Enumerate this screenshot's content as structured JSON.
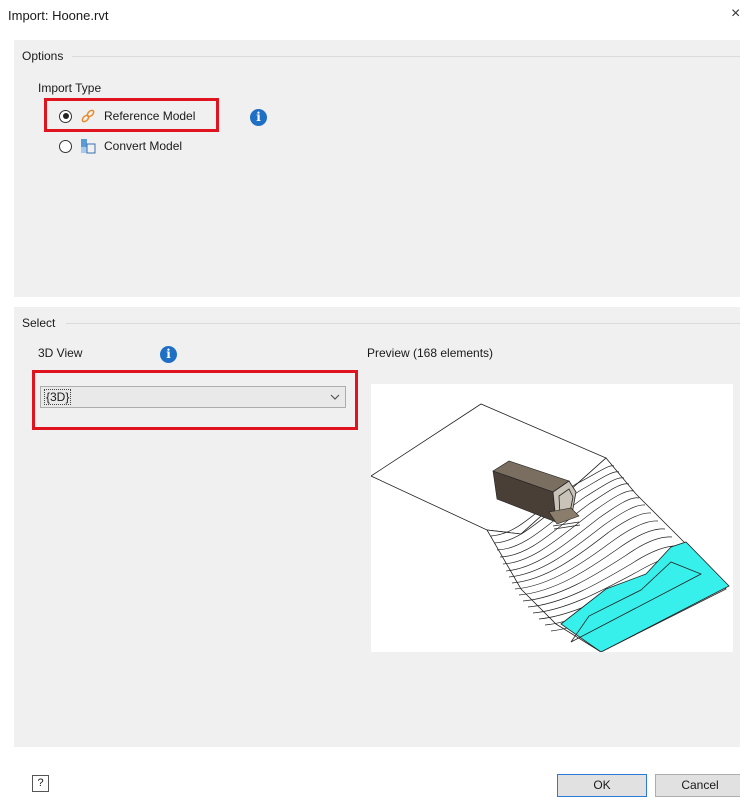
{
  "window": {
    "title": "Import: Hoone.rvt",
    "close_glyph": "×"
  },
  "options": {
    "section_label": "Options",
    "import_type_label": "Import Type",
    "choices": [
      {
        "label": "Reference Model",
        "selected": true,
        "icon": "link-icon"
      },
      {
        "label": "Convert Model",
        "selected": false,
        "icon": "convert-model-icon"
      }
    ],
    "info_glyph": "i"
  },
  "select": {
    "section_label": "Select",
    "view_label": "3D View",
    "view_value": "{3D}",
    "preview_label": "Preview (168 elements)"
  },
  "footer": {
    "help_glyph": "?",
    "ok_label": "OK",
    "cancel_label": "Cancel"
  },
  "colors": {
    "highlight": "#e0141e",
    "info": "#1f6fc4",
    "water": "#37f0ec",
    "section_bg": "#f0f0f0"
  }
}
